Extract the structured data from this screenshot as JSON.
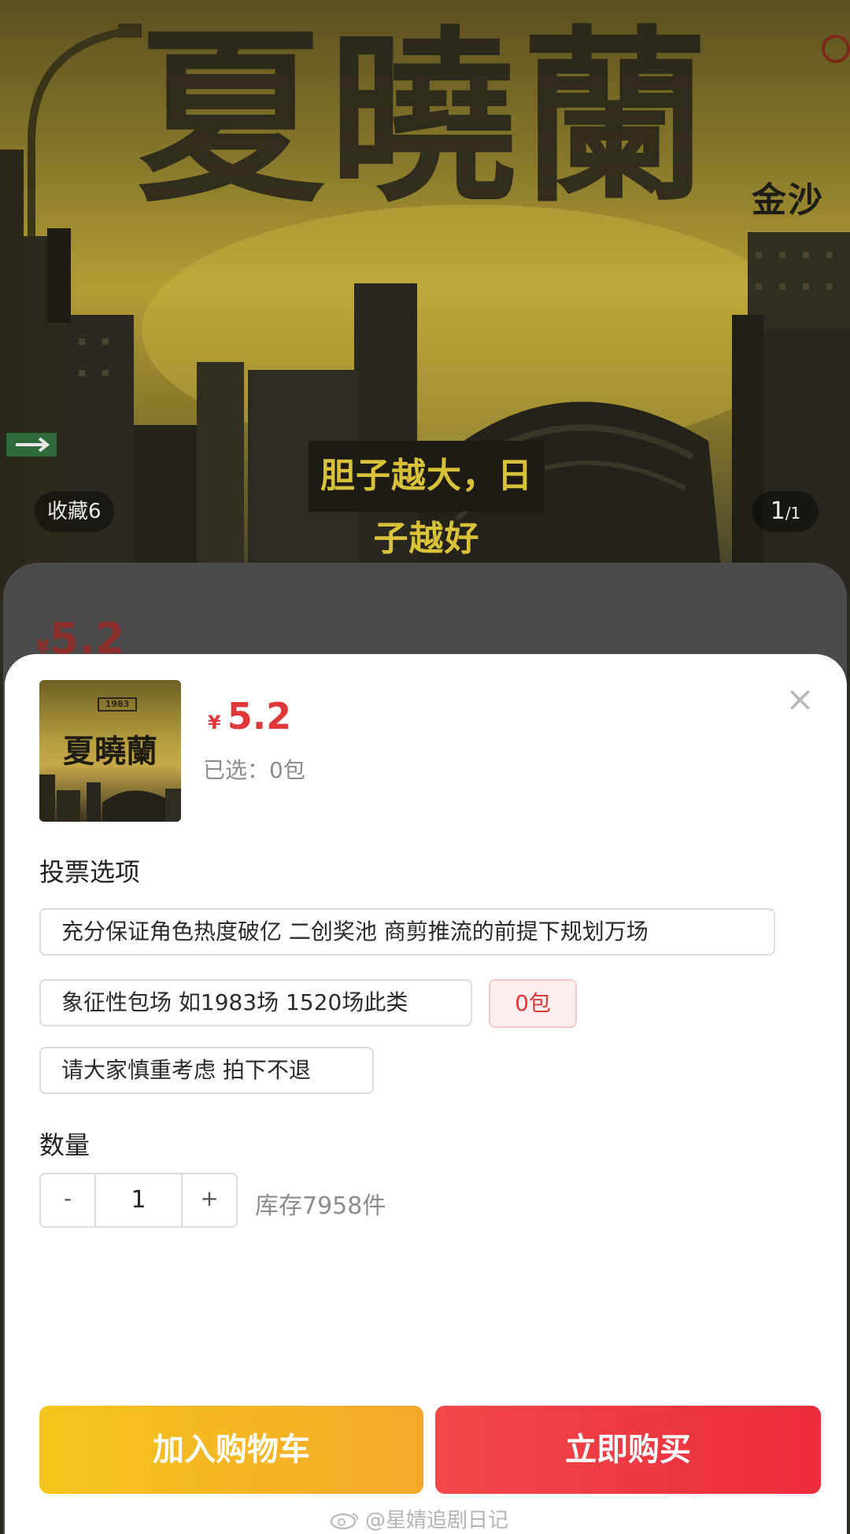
{
  "hero": {
    "title": "夏曉蘭",
    "tagline": "胆子越大，日子越好",
    "sign": "金沙",
    "favorites": "收藏6",
    "image_counter": {
      "current": "1",
      "total": "/1"
    }
  },
  "background_sheet": {
    "currency": "¥",
    "price": "5.2"
  },
  "sku_panel": {
    "thumbnail_title": "夏曉蘭",
    "thumbnail_logo": "1983",
    "currency": "¥",
    "price": "5.2",
    "selected_text": "已选：0包",
    "close_icon": "×",
    "vote_section_title": "投票选项",
    "options": [
      "充分保证角色热度破亿 二创奖池 商剪推流的前提下规划万场",
      "象征性包场 如1983场 1520场此类",
      "请大家慎重考虑 拍下不退"
    ],
    "option_badge": "0包",
    "quantity_title": "数量",
    "quantity": {
      "minus": "-",
      "value": "1",
      "plus": "+"
    },
    "stock_text": "库存7958件",
    "add_to_cart": "加入购物车",
    "buy_now": "立即购买",
    "watermark": "@星婧追剧日记"
  },
  "colors": {
    "price_red": "#e0383a",
    "cart_yellow": "#f4b822",
    "buy_red": "#ee3440",
    "sheet_bg": "#ffffff",
    "overlay": "#4b4b4b"
  }
}
